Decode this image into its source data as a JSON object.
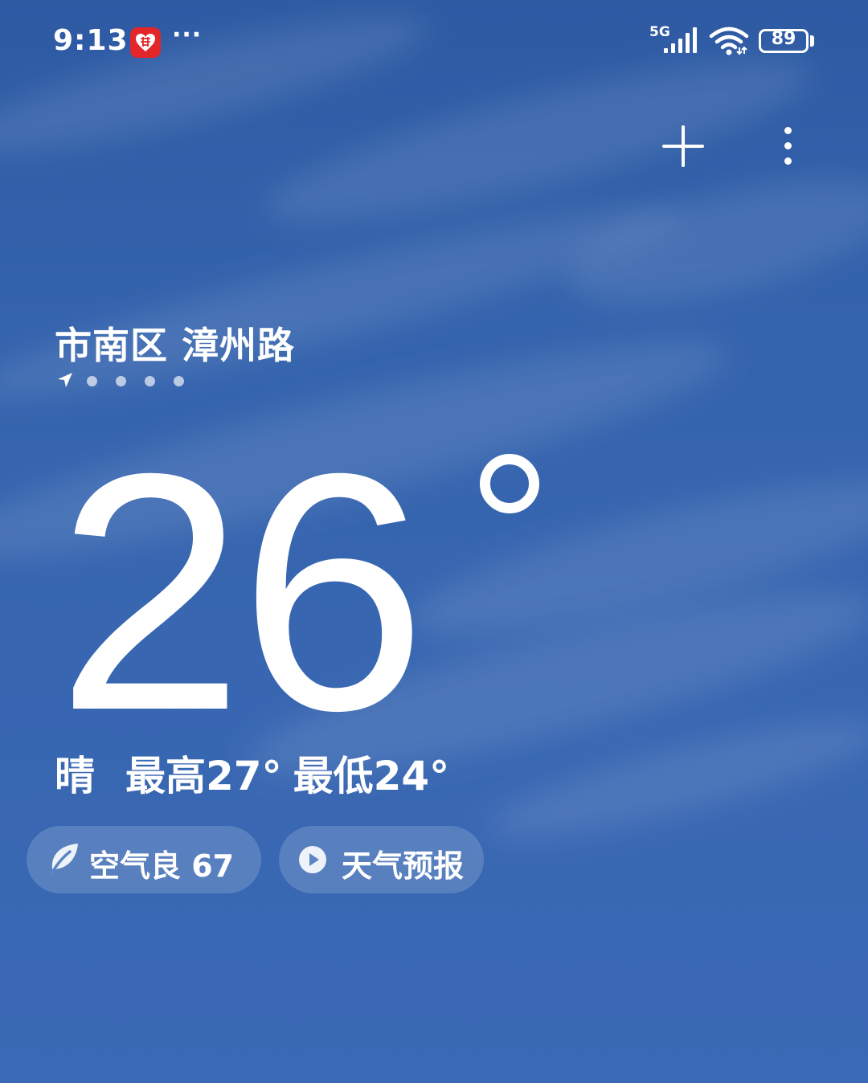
{
  "status_bar": {
    "time": "9:13",
    "more_notifications": "···",
    "network": "5G",
    "battery_level": "89"
  },
  "location": {
    "name": "市南区 漳州路",
    "page_count": 5,
    "current_page": 0
  },
  "weather": {
    "temperature": "26",
    "condition": "晴",
    "high": "最高27°",
    "low": "最低24°"
  },
  "pills": {
    "air_quality": "空气良 67",
    "forecast": "天气预报"
  },
  "colors": {
    "sky_top": "#2d5aa3",
    "sky_bottom": "#3a69b5",
    "notif_app": "#e3262a",
    "text": "#ffffff"
  },
  "icons": {
    "add": "plus-icon",
    "menu": "more-vertical-icon",
    "location": "location-arrow-icon",
    "air_quality": "leaf-icon",
    "forecast": "play-circle-icon"
  }
}
